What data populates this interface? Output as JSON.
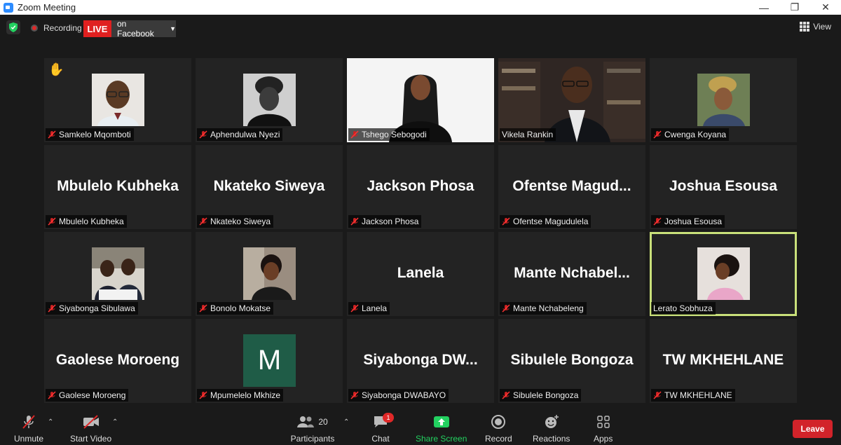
{
  "window": {
    "title": "Zoom Meeting",
    "minimize": "—",
    "restore": "❐",
    "close": "✕"
  },
  "topbar": {
    "recording_label": "Recording",
    "live_label": "LIVE",
    "stream_target": "on Facebook",
    "view_label": "View"
  },
  "participants": [
    {
      "display_name": "Samkelo Mqomboti",
      "raised_hand": true,
      "muted": true,
      "video": "photo"
    },
    {
      "display_name": "Aphendulwa Nyezi",
      "muted": true,
      "video": "photo"
    },
    {
      "display_name": "Tshego Sebogodi",
      "muted": true,
      "video": "camera"
    },
    {
      "display_name": "Vikela Rankin",
      "muted": false,
      "video": "camera"
    },
    {
      "display_name": "Cwenga Koyana",
      "muted": true,
      "video": "photo"
    },
    {
      "display_name": "Mbulelo Kubheka",
      "big_label": "Mbulelo Kubheka",
      "muted": true
    },
    {
      "display_name": "Nkateko Siweya",
      "big_label": "Nkateko Siweya",
      "muted": true
    },
    {
      "display_name": "Jackson Phosa",
      "big_label": "Jackson Phosa",
      "muted": true
    },
    {
      "display_name": "Ofentse Magudulela",
      "big_label": "Ofentse  Magud...",
      "muted": true
    },
    {
      "display_name": "Joshua Esousa",
      "big_label": "Joshua Esousa",
      "muted": true
    },
    {
      "display_name": "Siyabonga Sibulawa",
      "muted": true,
      "video": "photo"
    },
    {
      "display_name": "Bonolo Mokatse",
      "muted": true,
      "video": "photo"
    },
    {
      "display_name": "Lanela",
      "big_label": "Lanela",
      "muted": true
    },
    {
      "display_name": "Mante Nchabeleng",
      "big_label": "Mante  Nchabel...",
      "muted": true
    },
    {
      "display_name": "Lerato Sobhuza",
      "muted": false,
      "active_speaker": true,
      "video": "photo"
    },
    {
      "display_name": "Gaolese Moroeng",
      "big_label": "Gaolese Moroeng",
      "muted": true
    },
    {
      "display_name": "Mpumelelo Mkhize",
      "initial": "M",
      "muted": true
    },
    {
      "display_name": "Siyabonga DWABAYO",
      "big_label": "Siyabonga  DW...",
      "muted": true
    },
    {
      "display_name": "Sibulele Bongoza",
      "big_label": "Sibulele Bongoza",
      "muted": true
    },
    {
      "display_name": "TW MKHEHLANE",
      "big_label": "TW MKHEHLANE",
      "muted": true
    }
  ],
  "toolbar": {
    "unmute": "Unmute",
    "start_video": "Start Video",
    "participants_label": "Participants",
    "participants_count": "20",
    "chat": "Chat",
    "chat_badge": "1",
    "share_screen": "Share Screen",
    "record": "Record",
    "reactions": "Reactions",
    "apps": "Apps",
    "leave": "Leave"
  },
  "colors": {
    "live": "#e02020",
    "active_speaker_border": "#c9e07a",
    "share_green": "#23d160",
    "leave": "#d2232a",
    "initial_avatar": "#1f5c47"
  }
}
